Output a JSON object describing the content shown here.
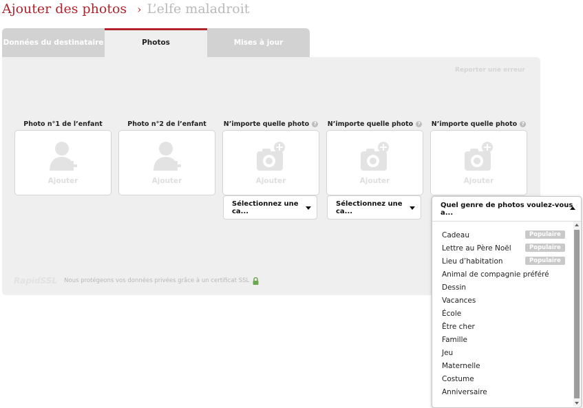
{
  "header": {
    "title": "Ajouter des photos",
    "separator": "›",
    "subtitle": "L’elfe maladroit"
  },
  "tabs": [
    {
      "label": "Données du destinataire",
      "active": false
    },
    {
      "label": "Photos",
      "active": true
    },
    {
      "label": "Mises à jour",
      "active": false
    }
  ],
  "panel": {
    "report_link": "Reporter une erreur"
  },
  "slots": [
    {
      "label": "Photo n°1 de l’enfant",
      "box_label": "Ajouter",
      "icon": "add-person-icon"
    },
    {
      "label": "Photo n°2 de l’enfant",
      "box_label": "Ajouter",
      "icon": "add-person-icon"
    },
    {
      "label": "N’importe quelle photo",
      "box_label": "Ajouter",
      "icon": "add-camera-icon",
      "help": "?"
    },
    {
      "label": "N’importe quelle photo",
      "box_label": "Ajouter",
      "icon": "add-camera-icon",
      "help": "?"
    },
    {
      "label": "N’importe quelle photo",
      "box_label": "Ajouter",
      "icon": "add-camera-icon",
      "help": "?"
    }
  ],
  "selects": [
    "Sélectionnez une ca...",
    "Sélectionnez une ca..."
  ],
  "ssl": {
    "logo": "RapidSSL",
    "text": "Nous protégeons vos données privées grâce à un certificat SSL"
  },
  "dropdown": {
    "header": "Quel genre de photos voulez-vous a...",
    "items": [
      {
        "label": "Cadeau",
        "badge": "Populaire"
      },
      {
        "label": "Lettre au Père Noël",
        "badge": "Populaire"
      },
      {
        "label": "Lieu d’habitation",
        "badge": "Populaire"
      },
      {
        "label": "Animal de compagnie préféré"
      },
      {
        "label": "Dessin"
      },
      {
        "label": "Vacances"
      },
      {
        "label": "École"
      },
      {
        "label": "Être cher"
      },
      {
        "label": "Famille"
      },
      {
        "label": "Jeu"
      },
      {
        "label": "Maternelle"
      },
      {
        "label": "Costume"
      },
      {
        "label": "Anniversaire"
      }
    ]
  },
  "colors": {
    "accent": "#b0232a",
    "panel": "#efefef",
    "tab_inactive": "#d2d2d2",
    "badge": "#c9c9c9",
    "lock": "#6aa84f"
  }
}
